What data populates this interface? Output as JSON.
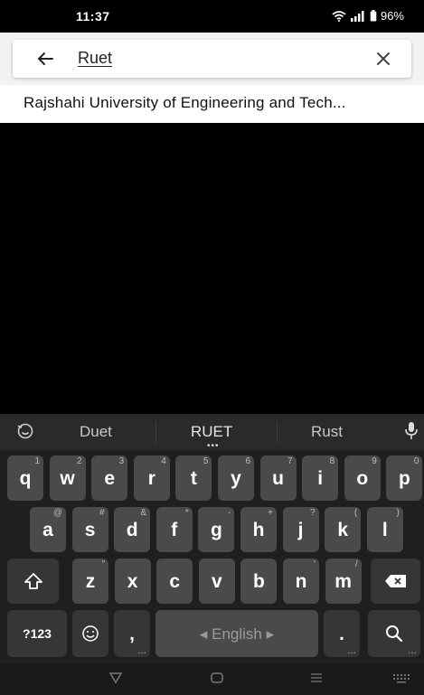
{
  "status_bar": {
    "time": "11:37",
    "battery": "96%"
  },
  "search": {
    "query": "Ruet"
  },
  "suggestions": [
    "Rajshahi University of Engineering and Tech..."
  ],
  "keyboard": {
    "word_suggestions": [
      "Duet",
      "RUET",
      "Rust"
    ],
    "row1": [
      {
        "k": "q",
        "h": "1"
      },
      {
        "k": "w",
        "h": "2"
      },
      {
        "k": "e",
        "h": "3"
      },
      {
        "k": "r",
        "h": "4"
      },
      {
        "k": "t",
        "h": "5"
      },
      {
        "k": "y",
        "h": "6"
      },
      {
        "k": "u",
        "h": "7"
      },
      {
        "k": "i",
        "h": "8"
      },
      {
        "k": "o",
        "h": "9"
      },
      {
        "k": "p",
        "h": "0"
      }
    ],
    "row2": [
      {
        "k": "a",
        "h": "@"
      },
      {
        "k": "s",
        "h": "#"
      },
      {
        "k": "d",
        "h": "&"
      },
      {
        "k": "f",
        "h": "*"
      },
      {
        "k": "g",
        "h": "-"
      },
      {
        "k": "h",
        "h": "+"
      },
      {
        "k": "j",
        "h": "?"
      },
      {
        "k": "k",
        "h": "("
      },
      {
        "k": "l",
        "h": ")"
      }
    ],
    "row3": [
      {
        "k": "z",
        "h": "\""
      },
      {
        "k": "x",
        "h": ""
      },
      {
        "k": "c",
        "h": ""
      },
      {
        "k": "v",
        "h": ""
      },
      {
        "k": "b",
        "h": ""
      },
      {
        "k": "n",
        "h": "'"
      },
      {
        "k": "m",
        "h": "/"
      }
    ],
    "symbols_key": "?123",
    "comma_key": ",",
    "space_label": "◂ English ▸",
    "period_key": "."
  },
  "colors": {
    "key": "#4a4a4a",
    "key_dark": "#363636",
    "keyboard_bg": "#1f1f1f"
  }
}
